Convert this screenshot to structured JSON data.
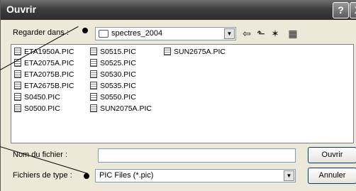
{
  "window": {
    "title": "Ouvrir",
    "help_label": "?",
    "close_label": "X"
  },
  "lookin": {
    "label": "Regarder dans :",
    "value": "spectres_2004"
  },
  "toolbar": {
    "back_glyph": "⇦",
    "up_glyph": "⬑",
    "newfolder_glyph": "✶",
    "views_glyph": "▦"
  },
  "files": [
    "ETA1950A.PIC",
    "ETA2075A.PIC",
    "ETA2075B.PIC",
    "ETA2675B.PIC",
    "S0450.PIC",
    "S0500.PIC",
    "S0515.PIC",
    "S0525.PIC",
    "S0530.PIC",
    "S0535.PIC",
    "S0550.PIC",
    "SUN2075A.PIC",
    "SUN2675A.PIC"
  ],
  "filename": {
    "label": "Nom du fichier :",
    "value": ""
  },
  "filetype": {
    "label": "Fichiers de type :",
    "value": "PIC Files (*.pic)"
  },
  "buttons": {
    "open_label": "Ouvrir",
    "cancel_label": "Annuler"
  }
}
